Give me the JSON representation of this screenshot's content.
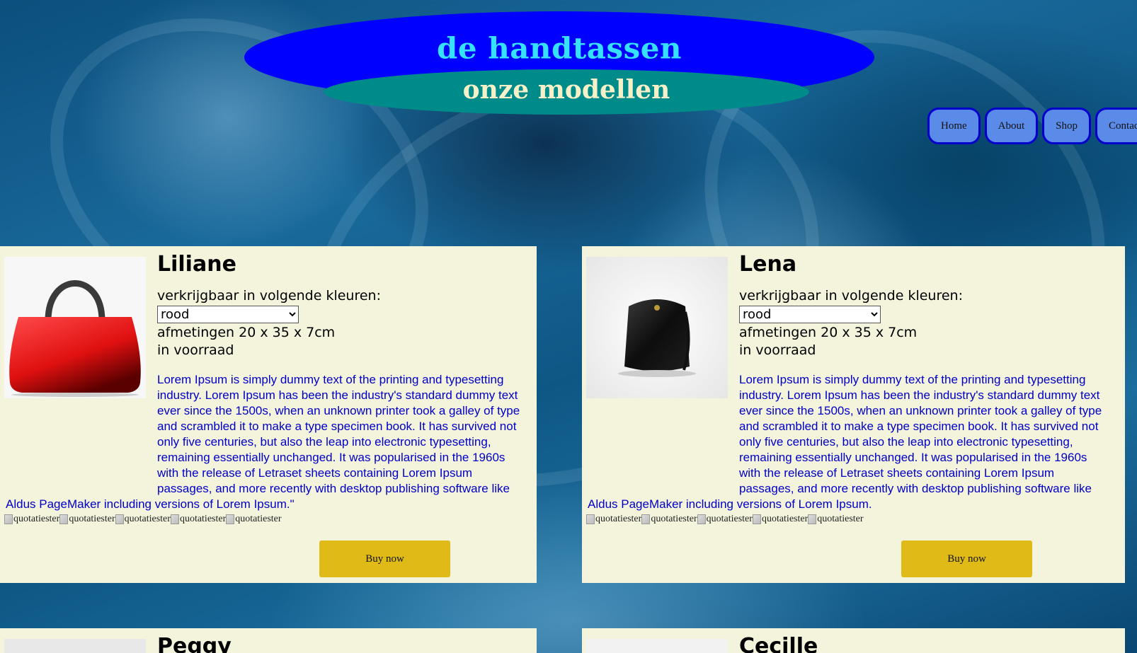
{
  "header": {
    "title": "de handtassen",
    "subtitle": "onze modellen"
  },
  "nav": {
    "items": [
      {
        "label": "Home"
      },
      {
        "label": "About"
      },
      {
        "label": "Shop"
      },
      {
        "label": "Contact"
      }
    ]
  },
  "products": [
    {
      "name": "Liliane",
      "colors_label": "verkrijgbaar in volgende kleuren:",
      "selected_color": "rood",
      "dimensions": "afmetingen 20 x 35 x 7cm",
      "stock": "in voorraad",
      "description": "Lorem Ipsum is simply dummy text of the printing and typesetting industry. Lorem Ipsum has been the industry's standard dummy text ever since the 1500s, when an unknown printer took a galley of type and scrambled it to make a type specimen book. It has survived not only five centuries, but also the leap into electronic typesetting, remaining essentially unchanged. It was popularised in the 1960s with the release of Letraset sheets containing Lorem Ipsum passages, and more recently with desktop publishing software like Aldus PageMaker including versions of Lorem Ipsum.\"",
      "rating_alt": "quotatiester",
      "buy_label": "Buy now",
      "image": "red-handbag"
    },
    {
      "name": "Lena",
      "colors_label": "verkrijgbaar in volgende kleuren:",
      "selected_color": "rood",
      "dimensions": "afmetingen 20 x 35 x 7cm",
      "stock": "in voorraad",
      "description": "Lorem Ipsum is simply dummy text of the printing and typesetting industry. Lorem Ipsum has been the industry's standard dummy text ever since the 1500s, when an unknown printer took a galley of type and scrambled it to make a type specimen book. It has survived not only five centuries, but also the leap into electronic typesetting, remaining essentially unchanged. It was popularised in the 1960s with the release of Letraset sheets containing Lorem Ipsum passages, and more recently with desktop publishing software like Aldus PageMaker including versions of Lorem Ipsum.",
      "rating_alt": "quotatiester",
      "buy_label": "Buy now",
      "image": "black-handbag"
    },
    {
      "name": "Peggy"
    },
    {
      "name": "Cecille"
    }
  ],
  "colors": {
    "title_ellipse": "#0000ff",
    "subtitle_ellipse": "#008b8b",
    "card_bg": "#f4f4dc",
    "buy_button": "#e0bb18",
    "nav_button": "#5b8be8",
    "description_text": "#0000c8"
  }
}
